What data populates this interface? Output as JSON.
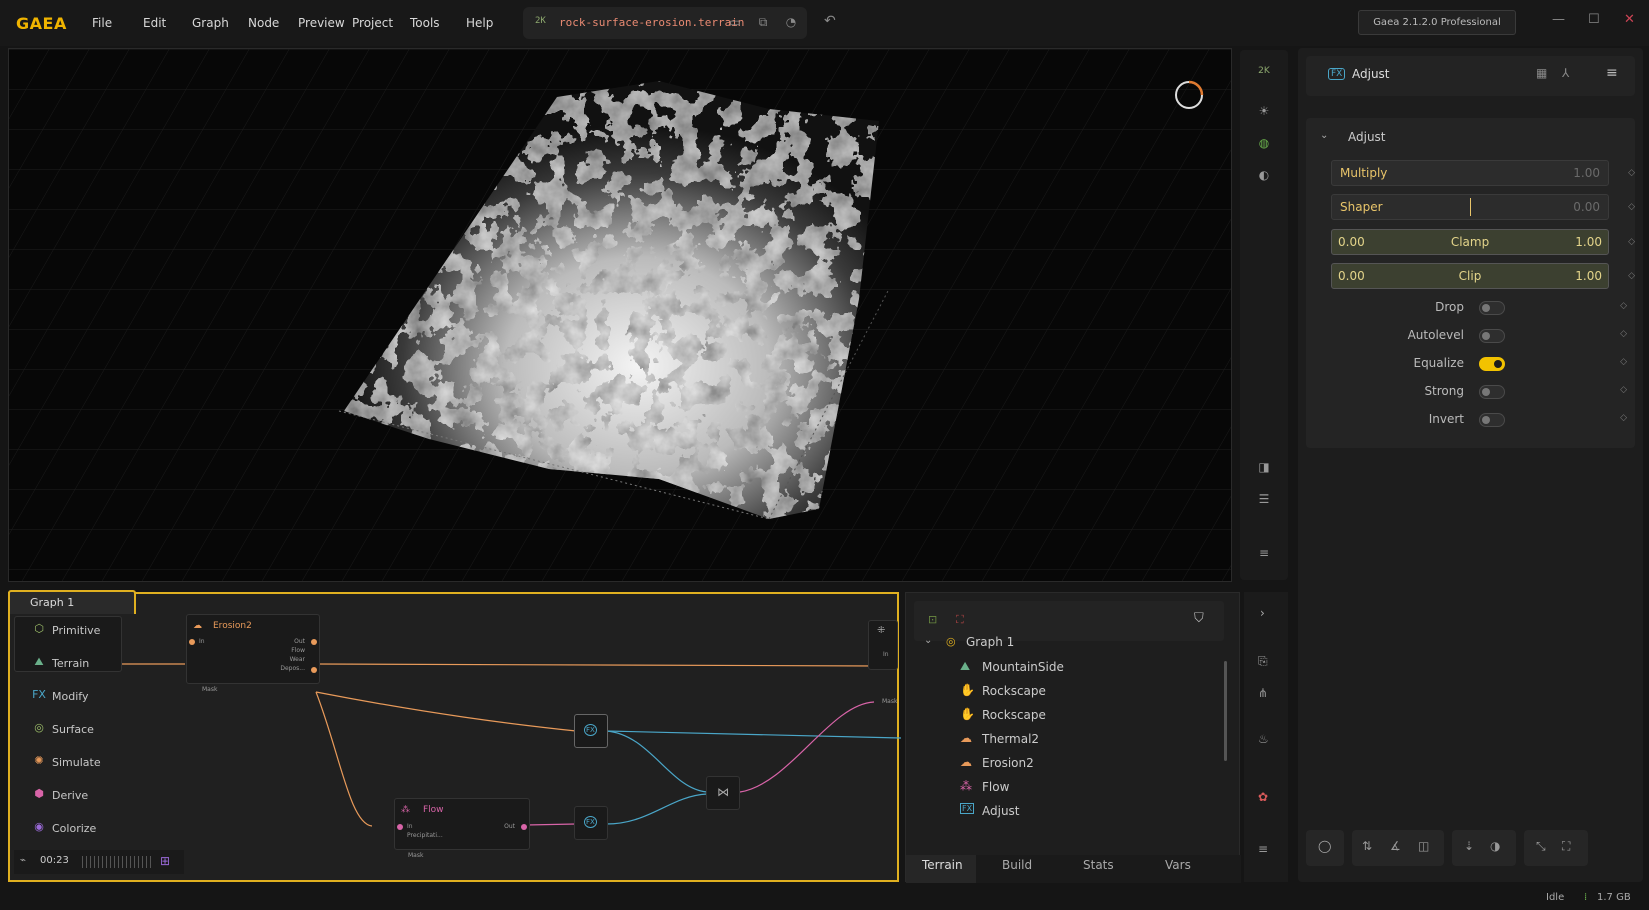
{
  "app": {
    "logo": "GAEA",
    "version": "Gaea 2.1.2.0 Professional"
  },
  "menu": [
    "File",
    "Edit",
    "Graph",
    "Node",
    "Preview",
    "Project",
    "Tools",
    "Help"
  ],
  "file": {
    "resolution": "2K",
    "name": "rock-surface-erosion.terrain"
  },
  "viewport_tools": {
    "resolution": "2K"
  },
  "property_panel": {
    "node_name": "Adjust",
    "section": "Adjust",
    "sliders": [
      {
        "label": "Multiply",
        "value": "1.00"
      },
      {
        "label": "Shaper",
        "value": "0.00"
      }
    ],
    "ranges": [
      {
        "label": "Clamp",
        "min": "0.00",
        "max": "1.00"
      },
      {
        "label": "Clip",
        "min": "0.00",
        "max": "1.00"
      }
    ],
    "toggles": [
      {
        "label": "Drop",
        "on": false
      },
      {
        "label": "Autolevel",
        "on": false
      },
      {
        "label": "Equalize",
        "on": true
      },
      {
        "label": "Strong",
        "on": false
      },
      {
        "label": "Invert",
        "on": false
      }
    ]
  },
  "graph": {
    "tab": "Graph 1",
    "categories": [
      "Primitive",
      "Terrain",
      "Modify",
      "Surface",
      "Simulate",
      "Derive",
      "Colorize"
    ],
    "nodes": {
      "erosion": {
        "title": "Erosion2",
        "in": "In",
        "outs": [
          "Out",
          "Flow",
          "Wear",
          "Depos..."
        ],
        "mask": "Mask"
      },
      "flow": {
        "title": "Flow",
        "ins": [
          "In",
          "Precipitati..."
        ],
        "out": "Out",
        "mask": "Mask"
      },
      "output": {
        "in": "In",
        "mask": "Mask"
      }
    },
    "timer": "00:23"
  },
  "tree": {
    "root": "Graph 1",
    "items": [
      "MountainSide",
      "Rockscape",
      "Rockscape",
      "Thermal2",
      "Erosion2",
      "Flow",
      "Adjust"
    ],
    "tabs": [
      "Terrain",
      "Build",
      "Stats",
      "Vars"
    ]
  },
  "status": {
    "state": "Idle",
    "memory": "1.7 GB"
  },
  "colors": {
    "accent": "#f0b400",
    "erosion": "#e89a5a",
    "flow": "#d864a8",
    "fx": "#4aa6c8"
  }
}
